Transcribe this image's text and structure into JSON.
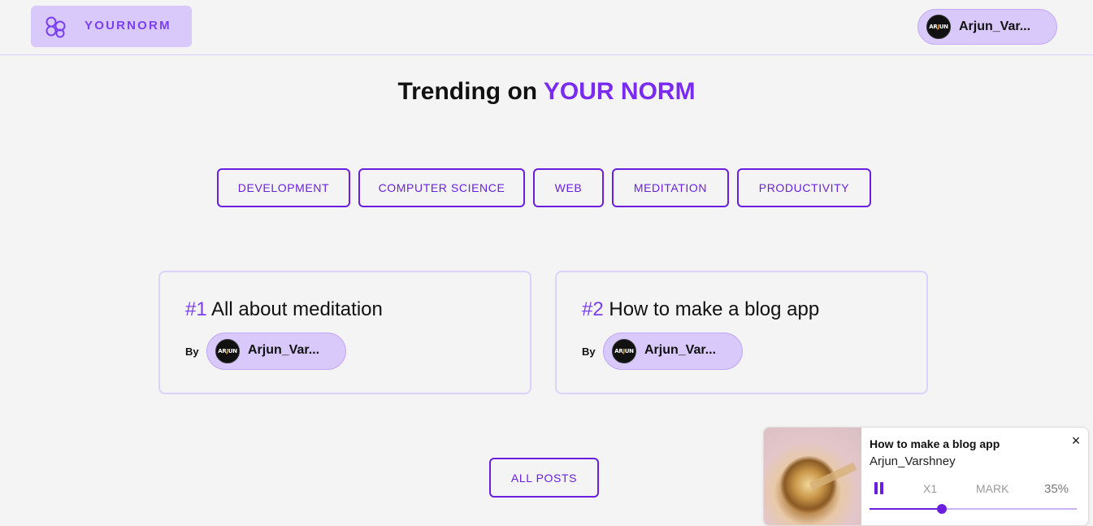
{
  "header": {
    "logo_text": "YOURNORM",
    "user": {
      "name": "Arjun_Var...",
      "avatar_text_a": "AR",
      "avatar_text_b": "J",
      "avatar_text_c": "UN"
    }
  },
  "title": {
    "prefix": "Trending on ",
    "accent": "YOUR NORM"
  },
  "tags": [
    "DEVELOPMENT",
    "COMPUTER SCIENCE",
    "WEB",
    "MEDITATION",
    "PRODUCTIVITY"
  ],
  "cards": [
    {
      "rank": "#1",
      "title": "All about meditation",
      "by": "By",
      "author": "Arjun_Var..."
    },
    {
      "rank": "#2",
      "title": "How to make a blog app",
      "by": "By",
      "author": "Arjun_Var..."
    }
  ],
  "all_posts_label": "ALL POSTS",
  "player": {
    "title": "How to make a blog app",
    "author": "Arjun_Varshney",
    "close_label": "×",
    "speed": "X1",
    "mark": "MARK",
    "progress_label": "35%",
    "progress": 0.35
  },
  "colors": {
    "accent": "#7a2bf0",
    "pill_bg": "#d9c9fb",
    "border": "#6a1fe0"
  }
}
